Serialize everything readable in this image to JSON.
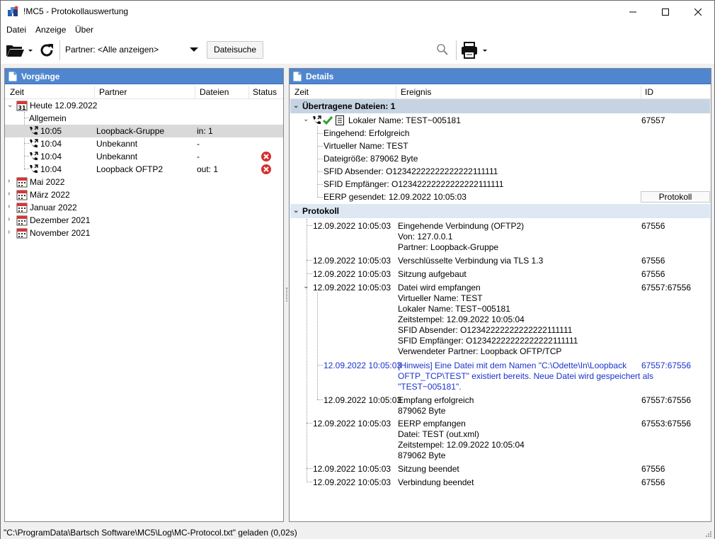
{
  "window": {
    "title": "!MC5 - Protokollauswertung"
  },
  "menu": [
    "Datei",
    "Anzeige",
    "Über"
  ],
  "toolbar": {
    "partner_filter": "Partner: <Alle anzeigen>",
    "file_search_label": "Dateisuche",
    "search_value": ""
  },
  "left_panel": {
    "title": "Vorgänge",
    "columns": [
      "Zeit",
      "Partner",
      "Dateien",
      "Status"
    ],
    "today": "Heute 12.09.2022",
    "calendar_day": "31",
    "general": "Allgemein",
    "rows": [
      {
        "time": "10:05",
        "partner": "Loopback-Gruppe",
        "files": "in: 1",
        "status": ""
      },
      {
        "time": "10:04",
        "partner": "Unbekannt",
        "files": "-",
        "status": ""
      },
      {
        "time": "10:04",
        "partner": "Unbekannt",
        "files": "-",
        "status": "error"
      },
      {
        "time": "10:04",
        "partner": "Loopback OFTP2",
        "files": "out: 1",
        "status": "error"
      }
    ],
    "months": [
      "Mai 2022",
      "März 2022",
      "Januar 2022",
      "Dezember 2021",
      "November 2021"
    ]
  },
  "right_panel": {
    "title": "Details",
    "columns": [
      "Zeit",
      "Ereignis",
      "ID"
    ],
    "files_group": "Übertragene Dateien: 1",
    "file": {
      "local_name": "Lokaler Name: TEST~005181",
      "id": "67557",
      "details": [
        "Eingehend: Erfolgreich",
        "Virtueller Name: TEST",
        "Dateigröße: 879062 Byte",
        "SFID Absender: O12342222222222222111111",
        "SFID Empfänger: O12342222222222222111111",
        "EERP gesendet: 12.09.2022 10:05:03"
      ],
      "protocol_button": "Protokoll"
    },
    "protocol_group": "Protokoll",
    "protocol": [
      {
        "time": "12.09.2022 10:05:03",
        "lines": [
          "Eingehende Verbindung (OFTP2)",
          "Von: 127.0.0.1",
          "Partner: Loopback-Gruppe"
        ],
        "id": "67556"
      },
      {
        "time": "12.09.2022 10:05:03",
        "lines": [
          "Verschlüsselte Verbindung via TLS 1.3"
        ],
        "id": "67556"
      },
      {
        "time": "12.09.2022 10:05:03",
        "lines": [
          "Sitzung aufgebaut"
        ],
        "id": "67556"
      },
      {
        "time": "12.09.2022 10:05:03",
        "lines": [
          "Datei wird empfangen",
          "Virtueller Name: TEST",
          "Lokaler Name: TEST~005181",
          "Zeitstempel: 12.09.2022 10:05:04",
          "SFID Absender: O12342222222222222111111",
          "SFID Empfänger: O12342222222222222111111",
          "Verwendeter Partner: Loopback OFTP/TCP"
        ],
        "id": "67557:67556"
      },
      {
        "time": "12.09.2022 10:05:03",
        "lines": [
          "[Hinweis] Eine Datei mit dem Namen \"C:\\Odette\\In\\Loopback",
          "OFTP_TCP\\TEST\" existiert bereits. Neue Datei wird gespeichert als",
          "\"TEST~005181\"."
        ],
        "id": "67557:67556"
      },
      {
        "time": "12.09.2022 10:05:03",
        "lines": [
          "Empfang erfolgreich",
          "879062 Byte"
        ],
        "id": "67557:67556"
      },
      {
        "time": "12.09.2022 10:05:03",
        "lines": [
          "EERP empfangen",
          "Datei: TEST (out.xml)",
          "Zeitstempel: 12.09.2022 10:05:04",
          "879062 Byte"
        ],
        "id": "67553:67556"
      },
      {
        "time": "12.09.2022 10:05:03",
        "lines": [
          "Sitzung beendet"
        ],
        "id": "67556"
      },
      {
        "time": "12.09.2022 10:05:03",
        "lines": [
          "Verbindung beendet"
        ],
        "id": "67556"
      }
    ]
  },
  "status_bar": "\"C:\\ProgramData\\Bartsch Software\\MC5\\Log\\MC-Protocol.txt\" geladen (0,02s)",
  "colors": {
    "panel_header": "#4f86cf",
    "group_row": "#c6d3e2",
    "hint_text": "#1a33cc",
    "error_icon": "#d32f2f",
    "check_icon": "#2e9d2e"
  }
}
